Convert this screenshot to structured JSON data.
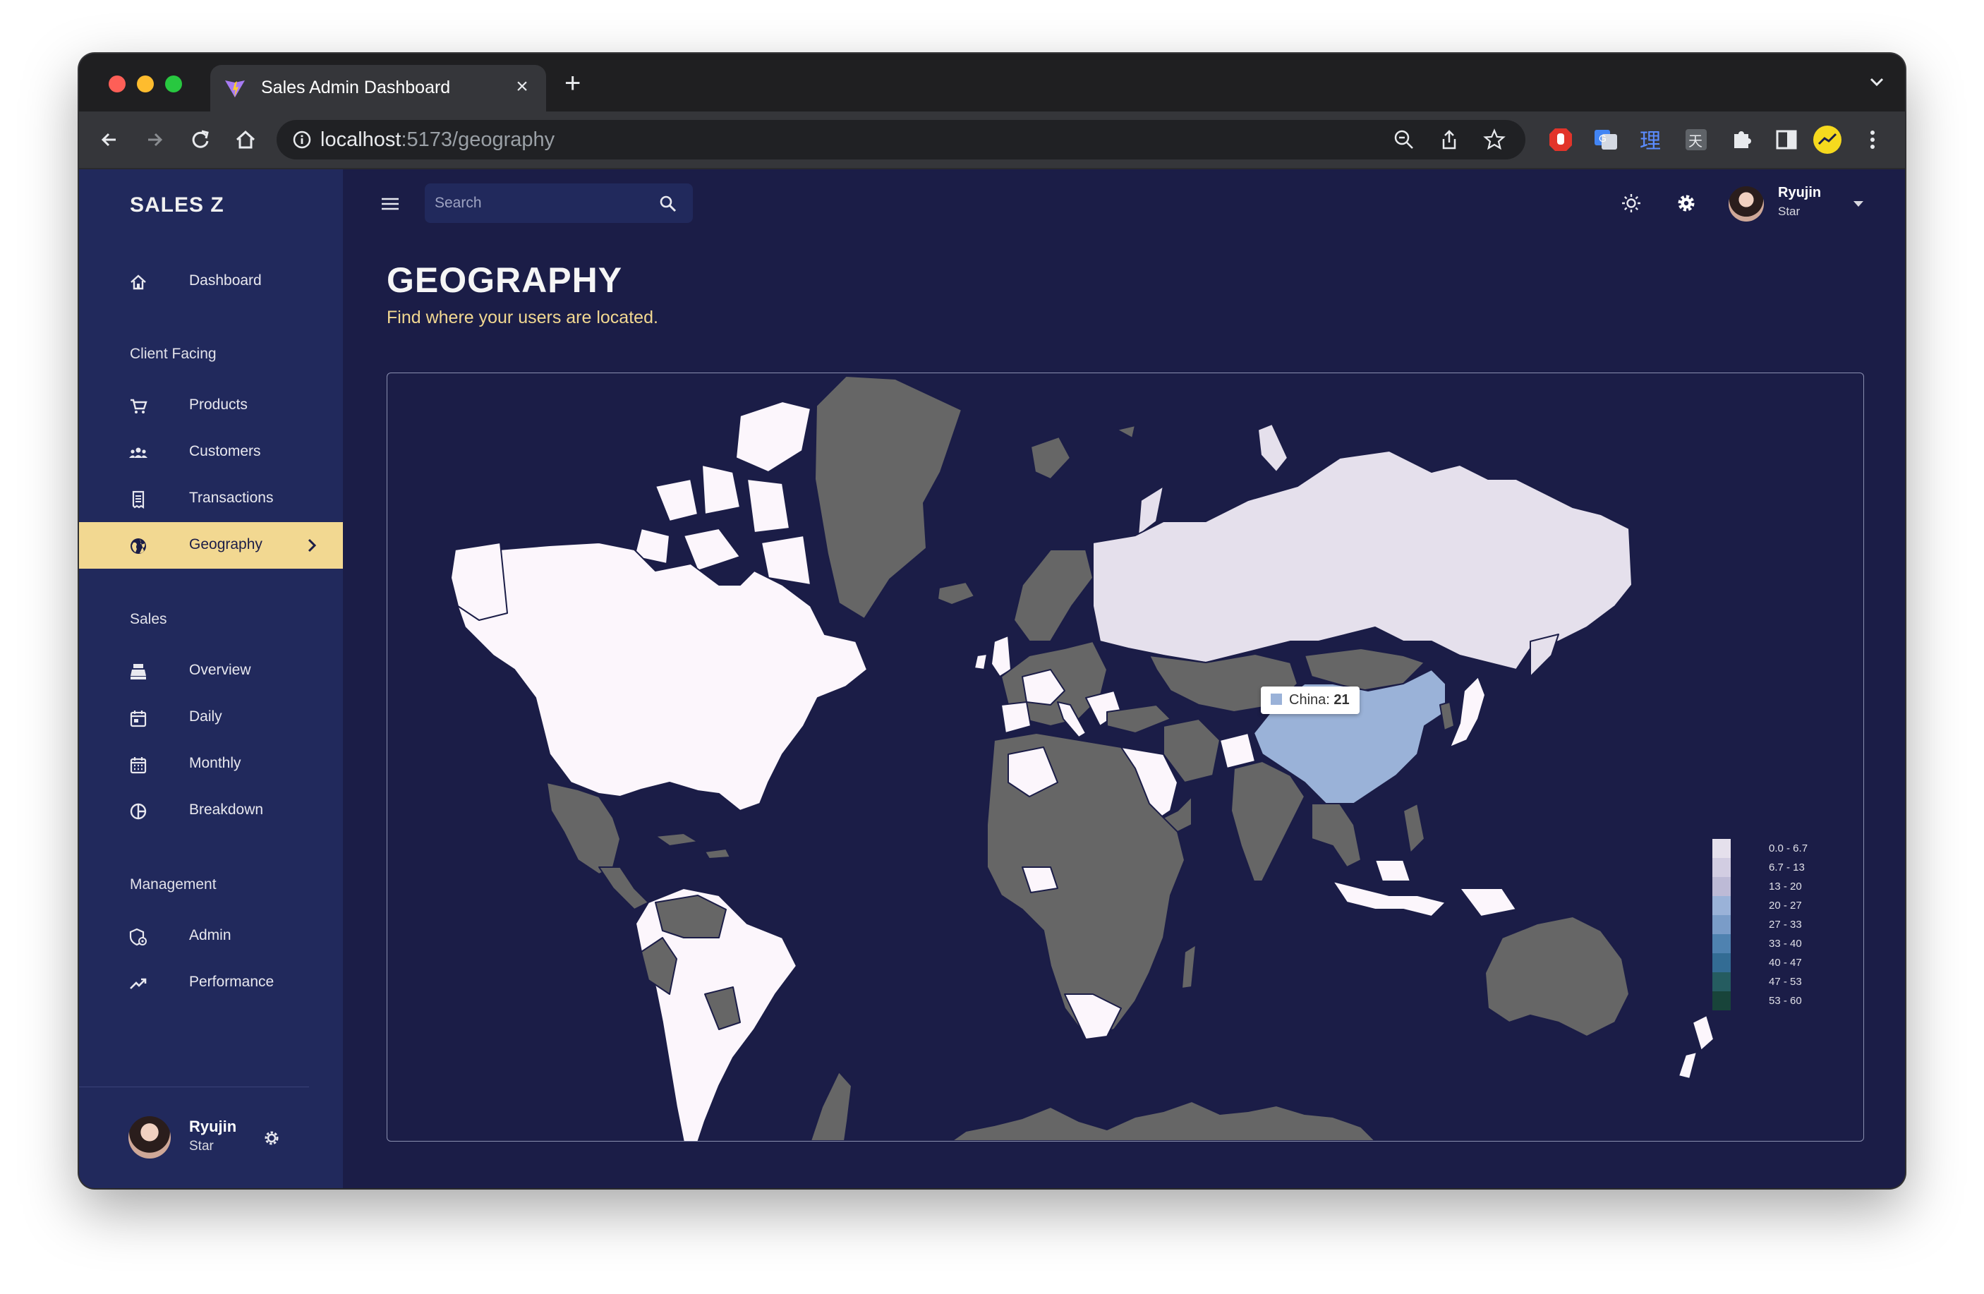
{
  "browser": {
    "tab_title": "Sales Admin Dashboard",
    "url_host": "localhost",
    "url_path": ":5173/geography"
  },
  "sidebar": {
    "brand": "SALES Z",
    "items": [
      {
        "label": "Dashboard",
        "icon": "home-icon"
      },
      {
        "section": "Client Facing"
      },
      {
        "label": "Products",
        "icon": "shopping-cart-icon"
      },
      {
        "label": "Customers",
        "icon": "groups-icon"
      },
      {
        "label": "Transactions",
        "icon": "receipt-icon"
      },
      {
        "label": "Geography",
        "icon": "globe-icon",
        "active": true
      },
      {
        "section": "Sales"
      },
      {
        "label": "Overview",
        "icon": "point-of-sale-icon"
      },
      {
        "label": "Daily",
        "icon": "calendar-day-icon"
      },
      {
        "label": "Monthly",
        "icon": "calendar-month-icon"
      },
      {
        "label": "Breakdown",
        "icon": "pie-chart-icon"
      },
      {
        "section": "Management"
      },
      {
        "label": "Admin",
        "icon": "admin-icon"
      },
      {
        "label": "Performance",
        "icon": "trending-up-icon"
      }
    ],
    "user": {
      "name": "Ryujin",
      "role": "Star"
    }
  },
  "topbar": {
    "search_placeholder": "Search",
    "user": {
      "name": "Ryujin",
      "role": "Star"
    }
  },
  "page": {
    "title": "GEOGRAPHY",
    "subtitle": "Find where your users are located."
  },
  "map": {
    "tooltip": {
      "country": "China",
      "value": "21"
    },
    "legend": [
      {
        "label": "0.0 - 6.7",
        "color": "#e5e0ec"
      },
      {
        "label": "6.7 - 13",
        "color": "#d2cde2"
      },
      {
        "label": "13 - 20",
        "color": "#bdbad6"
      },
      {
        "label": "20 - 27",
        "color": "#9ab2d8"
      },
      {
        "label": "27 - 33",
        "color": "#7a9cc8"
      },
      {
        "label": "33 - 40",
        "color": "#4f82b0"
      },
      {
        "label": "40 - 47",
        "color": "#336c94"
      },
      {
        "label": "47 - 53",
        "color": "#255c60"
      },
      {
        "label": "53 - 60",
        "color": "#18443a"
      }
    ],
    "colors": {
      "no_data": "#666666",
      "light": "#fcf6fc",
      "russia": "#e5e0ec",
      "china": "#9ab2d8",
      "ocean": "#1b1d47"
    }
  }
}
